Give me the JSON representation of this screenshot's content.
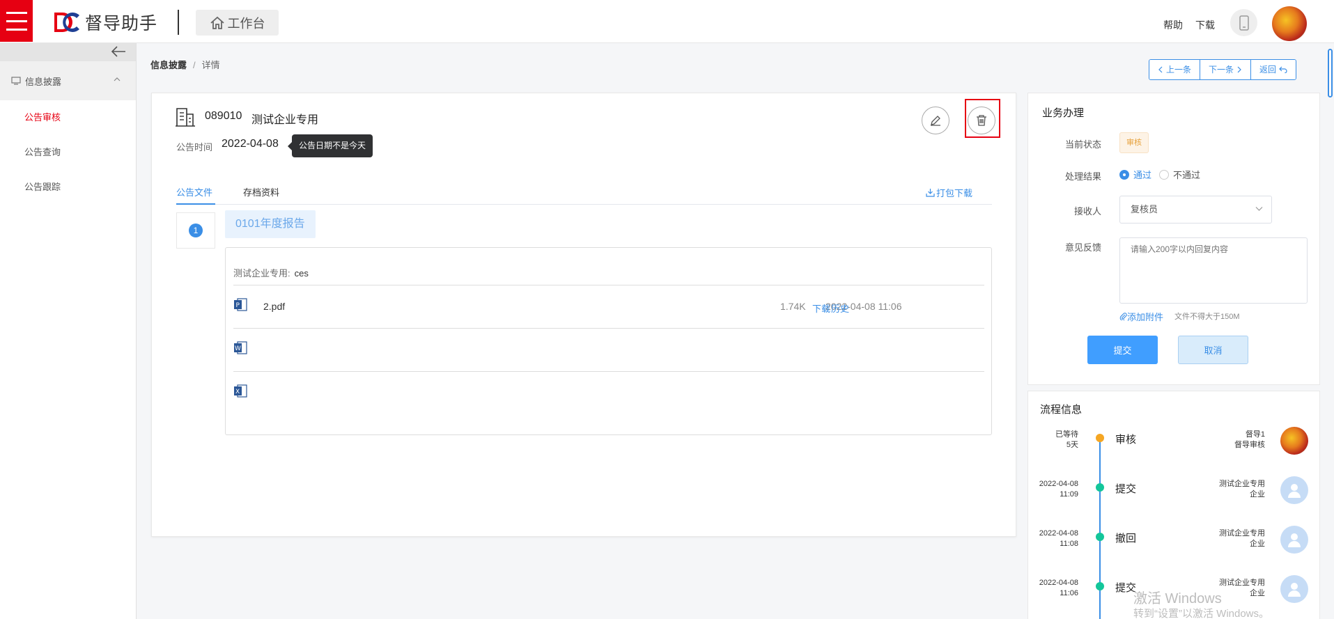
{
  "header": {
    "app_name": "督导助手",
    "workbench_label": "工作台",
    "help_label": "帮助",
    "download_label": "下载"
  },
  "sidebar": {
    "group_label": "信息披露",
    "items": [
      {
        "label": "公告审核",
        "active": true
      },
      {
        "label": "公告查询",
        "active": false
      },
      {
        "label": "公告跟踪",
        "active": false
      }
    ]
  },
  "breadcrumb": {
    "root": "信息披露",
    "separator": "/",
    "current": "详情"
  },
  "pager": {
    "prev": "上一条",
    "next": "下一条",
    "back": "返回"
  },
  "detail": {
    "code": "089010",
    "company": "测试企业专用",
    "announce_label": "公告时间",
    "announce_date": "2022-04-08",
    "tooltip": "公告日期不是今天"
  },
  "tabs": {
    "items": [
      "公告文件",
      "存档资料"
    ],
    "pack_download": "打包下载"
  },
  "files": {
    "index": "1",
    "report_title": "0101年度报告",
    "desc_label": "测试企业专用:",
    "desc_value": "ces",
    "rows": [
      {
        "icon": "pdf-file-icon",
        "name": "2.pdf",
        "size": "1.74K",
        "time": "2022-04-08 11:06",
        "download": "下载",
        "history": "历史"
      },
      {
        "icon": "word-file-icon",
        "name": "",
        "size": "",
        "time": "",
        "download": "",
        "history": ""
      },
      {
        "icon": "excel-file-icon",
        "name": "",
        "size": "",
        "time": "",
        "download": "",
        "history": ""
      }
    ]
  },
  "business": {
    "title": "业务办理",
    "status_label": "当前状态",
    "status_value": "审核",
    "result_label": "处理结果",
    "result_pass": "通过",
    "result_fail": "不通过",
    "receiver_label": "接收人",
    "receiver_value": "复核员",
    "feedback_label": "意见反馈",
    "feedback_placeholder": "请输入200字以内回复内容",
    "attach_label": "添加附件",
    "attach_note": "文件不得大于150M",
    "submit": "提交",
    "cancel": "取消"
  },
  "flow": {
    "title": "流程信息",
    "items": [
      {
        "time1": "已等待",
        "time2": "5天",
        "action": "审核",
        "user1": "督导1",
        "user2": "督导审核",
        "state": "wait"
      },
      {
        "time1": "2022-04-08",
        "time2": "11:09",
        "action": "提交",
        "user1": "测试企业专用",
        "user2": "企业",
        "state": "done"
      },
      {
        "time1": "2022-04-08",
        "time2": "11:08",
        "action": "撤回",
        "user1": "测试企业专用",
        "user2": "企业",
        "state": "done"
      },
      {
        "time1": "2022-04-08",
        "time2": "11:06",
        "action": "提交",
        "user1": "测试企业专用",
        "user2": "企业",
        "state": "done"
      }
    ]
  },
  "watermark": {
    "line1": "激活 Windows",
    "line2": "转到“设置”以激活 Windows。"
  },
  "colors": {
    "brand_red": "#e60012",
    "primary_blue": "#3a8ee6",
    "status_orange": "#e6a23c",
    "flow_green": "#13c69a"
  }
}
